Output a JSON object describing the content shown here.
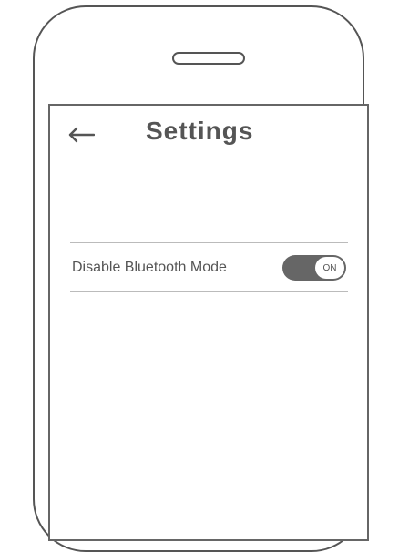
{
  "header": {
    "title": "Settings",
    "back_icon": "back-arrow-icon"
  },
  "settings": [
    {
      "label": "Disable Bluetooth Mode",
      "toggle_state_label": "ON",
      "enabled": true
    }
  ],
  "colors": {
    "primary_text": "#555555",
    "toggle_on_track": "#666666",
    "divider": "#bbbbbb"
  }
}
